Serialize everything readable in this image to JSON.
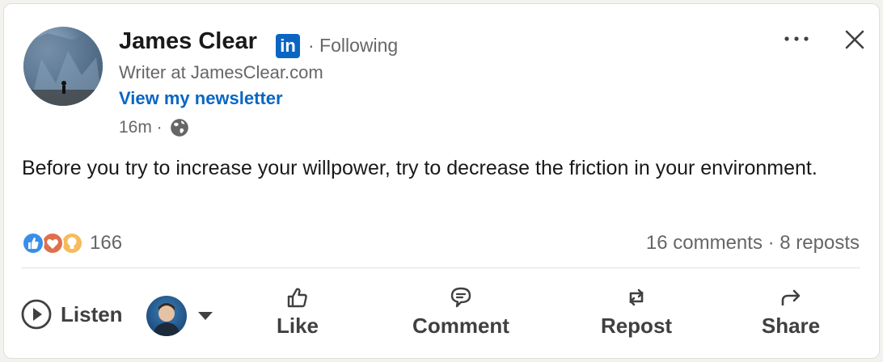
{
  "author": {
    "name": "James Clear",
    "network_badge": "in",
    "follow_status": "· Following",
    "headline": "Writer at JamesClear.com",
    "newsletter_link": "View my newsletter",
    "time": "16m ·",
    "visibility_icon": "globe-icon"
  },
  "post": {
    "text": "Before you try to increase your willpower, try to decrease the friction in your environment."
  },
  "social": {
    "reaction_icons": [
      "like-icon",
      "love-icon",
      "insightful-icon"
    ],
    "reaction_count": "166",
    "stats": "16 comments · 8 reposts"
  },
  "actions": {
    "listen_label": "Listen",
    "like_label": "Like",
    "comment_label": "Comment",
    "repost_label": "Repost",
    "share_label": "Share"
  },
  "colors": {
    "brand_blue": "#0a66c2",
    "text_primary": "#191919",
    "text_secondary": "#666666",
    "action_text": "#404040"
  }
}
